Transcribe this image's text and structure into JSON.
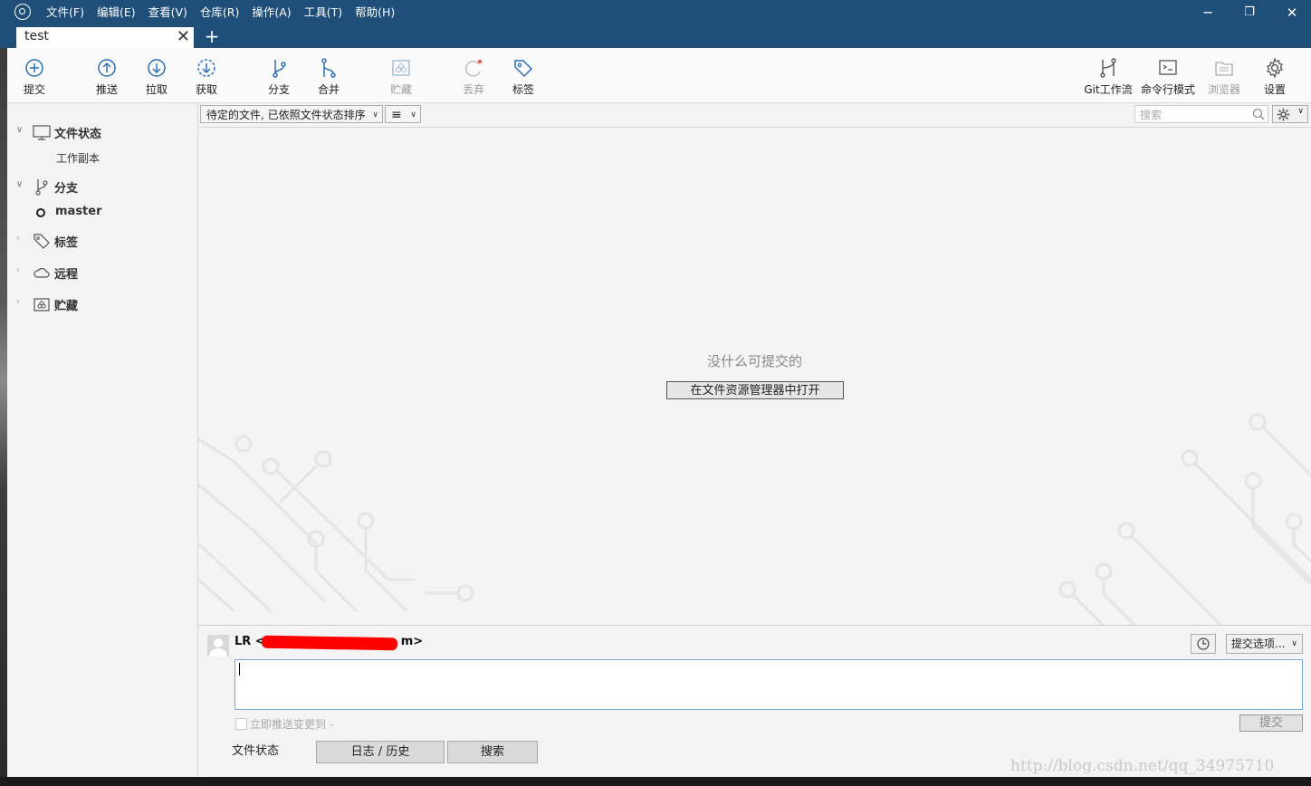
{
  "window": {
    "menu": [
      "文件(F)",
      "编辑(E)",
      "查看(V)",
      "仓库(R)",
      "操作(A)",
      "工具(T)",
      "帮助(H)"
    ],
    "controls": {
      "minimize": "─",
      "restore": "❐",
      "close": "✕"
    }
  },
  "tabs": {
    "active": "test",
    "close": "✕",
    "new": "+"
  },
  "toolbar": {
    "commit": "提交",
    "push": "推送",
    "pull": "拉取",
    "fetch": "获取",
    "branch": "分支",
    "merge": "合并",
    "stash": "贮藏",
    "discard": "丢弃",
    "tag": "标签",
    "gitflow": "Git工作流",
    "terminal": "命令行模式",
    "explorer": "浏览器",
    "settings": "设置"
  },
  "sidebar": {
    "file_status": "文件状态",
    "working_copy": "工作副本",
    "branches": "分支",
    "current_branch": "master",
    "tags": "标签",
    "remotes": "远程",
    "stashes": "贮藏"
  },
  "filter": {
    "sort_label": "待定的文件, 已依照文件状态排序",
    "list_icon": "≡",
    "search_placeholder": "搜索"
  },
  "content": {
    "empty_message": "没什么可提交的",
    "open_explorer": "在文件资源管理器中打开"
  },
  "commit": {
    "author": "LR <",
    "author_end": "m>",
    "options": "提交选项...",
    "push_immediately": "立即推送变更到 -",
    "submit": "提交"
  },
  "bottom_tabs": {
    "file_status": "文件状态",
    "log_history": "日志 / 历史",
    "search": "搜索"
  },
  "watermark": "http://blog.csdn.net/qq_34975710",
  "colors": {
    "titlebar": "#1f4e79",
    "icon_blue": "#2f6fb6",
    "disabled": "#9a9a9a"
  }
}
